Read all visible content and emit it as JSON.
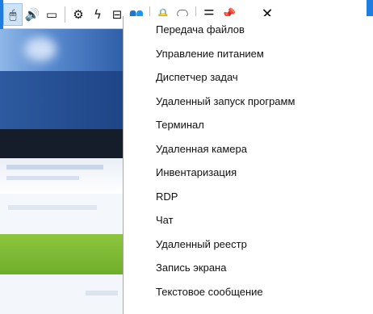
{
  "toolbar": {
    "buttons": [
      {
        "name": "mouse-icon",
        "glyph": "🖱",
        "active": true
      },
      {
        "name": "speaker-icon",
        "glyph": "🔊"
      },
      {
        "name": "camera-icon",
        "glyph": "▭"
      },
      {
        "name": "gear-icon",
        "glyph": "⚙"
      },
      {
        "name": "power-icon",
        "glyph": "ϟ"
      },
      {
        "name": "network-icon",
        "glyph": "⊟"
      },
      {
        "name": "users-icon",
        "glyph": "👥"
      },
      {
        "name": "lock-icon",
        "glyph": "🔒"
      },
      {
        "name": "chat-icon",
        "glyph": "🗨"
      },
      {
        "name": "list-menu-icon",
        "glyph": "☰"
      },
      {
        "name": "pin-icon",
        "glyph": "📌"
      },
      {
        "name": "minimize-icon",
        "glyph": "_"
      },
      {
        "name": "close-icon",
        "glyph": "✕"
      }
    ]
  },
  "menu": {
    "items": [
      "Передача файлов",
      "Управление питанием",
      "Диспетчер задач",
      "Удаленный запуск программ",
      "Терминал",
      "Удаленная камера",
      "Инвентаризация",
      "RDP",
      "Чат",
      "Удаленный реестр",
      "Запись экрана",
      "Текстовое сообщение"
    ]
  },
  "colors": {
    "accent": "#1e7de0",
    "active_bg": "#cfe3f7"
  }
}
